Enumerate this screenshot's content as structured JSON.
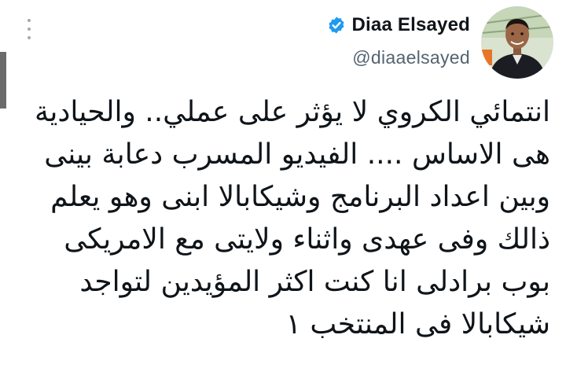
{
  "author": {
    "display_name": "Diaa Elsayed",
    "handle": "@diaaelsayed"
  },
  "icons": {
    "verified": "verified-badge-icon",
    "more": "more-options-icon"
  },
  "colors": {
    "verified_blue": "#1d9bf0",
    "text_primary": "#0f1419",
    "text_secondary": "#536471"
  },
  "tweet": {
    "lines": [
      "انتمائي الكروي لا يؤثر على عملي.. والحيادية",
      "هى الاساس .... الفيديو المسرب دعابة بينى",
      "وبين اعداد البرنامج وشيكابالا ابنى وهو يعلم",
      "ذالك وفى عهدى واثناء ولايتى مع الامريكى",
      "بوب برادلى انا كنت اكثر المؤيدين لتواجد",
      "شيكابالا فى المنتخب ١"
    ]
  }
}
